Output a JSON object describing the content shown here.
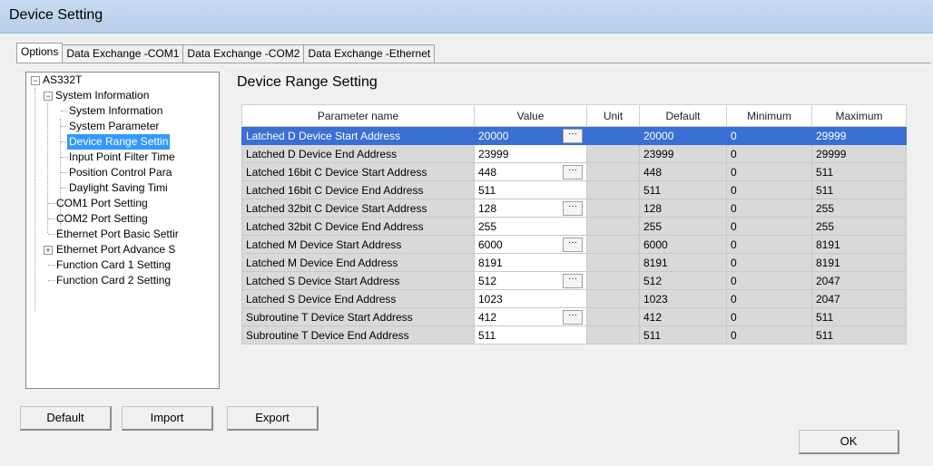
{
  "window": {
    "title": "Device Setting"
  },
  "tabs": [
    "Options",
    "Data Exchange -COM1",
    "Data Exchange -COM2",
    "Data Exchange -Ethernet"
  ],
  "tree": {
    "root": "AS332T",
    "items": [
      "System Information",
      "System Information",
      "System Parameter",
      "Device Range Settin",
      "Input Point Filter Time",
      "Position Control Para",
      "Daylight Saving Timi",
      "COM1 Port Setting",
      "COM2 Port Setting",
      "Ethernet Port Basic Settir",
      "Ethernet Port Advance S",
      "Function Card 1 Setting",
      "Function Card 2 Setting"
    ],
    "selected_index": 3
  },
  "section": {
    "title": "Device Range Setting"
  },
  "table": {
    "headers": [
      "Parameter name",
      "Value",
      "Unit",
      "Default",
      "Minimum",
      "Maximum"
    ],
    "rows": [
      [
        "Latched D Device Start Address",
        "20000",
        "",
        "20000",
        "0",
        "29999"
      ],
      [
        "Latched D Device End Address",
        "23999",
        "",
        "23999",
        "0",
        "29999"
      ],
      [
        "Latched 16bit C Device Start Address",
        "448",
        "",
        "448",
        "0",
        "511"
      ],
      [
        "Latched 16bit C Device End Address",
        "511",
        "",
        "511",
        "0",
        "511"
      ],
      [
        "Latched 32bit C Device Start Address",
        "128",
        "",
        "128",
        "0",
        "255"
      ],
      [
        "Latched 32bit C Device End Address",
        "255",
        "",
        "255",
        "0",
        "255"
      ],
      [
        "Latched M Device Start Address",
        "6000",
        "",
        "6000",
        "0",
        "8191"
      ],
      [
        "Latched M Device End Address",
        "8191",
        "",
        "8191",
        "0",
        "8191"
      ],
      [
        "Latched S Device Start Address",
        "512",
        "",
        "512",
        "0",
        "2047"
      ],
      [
        "Latched S Device End Address",
        "1023",
        "",
        "1023",
        "0",
        "2047"
      ],
      [
        "Subroutine T Device Start Address",
        "412",
        "",
        "412",
        "0",
        "511"
      ],
      [
        "Subroutine T Device End Address",
        "511",
        "",
        "511",
        "0",
        "511"
      ]
    ],
    "selected_row": 0,
    "ellipsis_label": "···"
  },
  "buttons": {
    "default": "Default",
    "import": "Import",
    "export": "Export",
    "ok": "OK"
  },
  "colors": {
    "selection": "#3a6fd4",
    "tree_selection": "#3399ff",
    "readonly_cell": "#d9d9d9"
  }
}
